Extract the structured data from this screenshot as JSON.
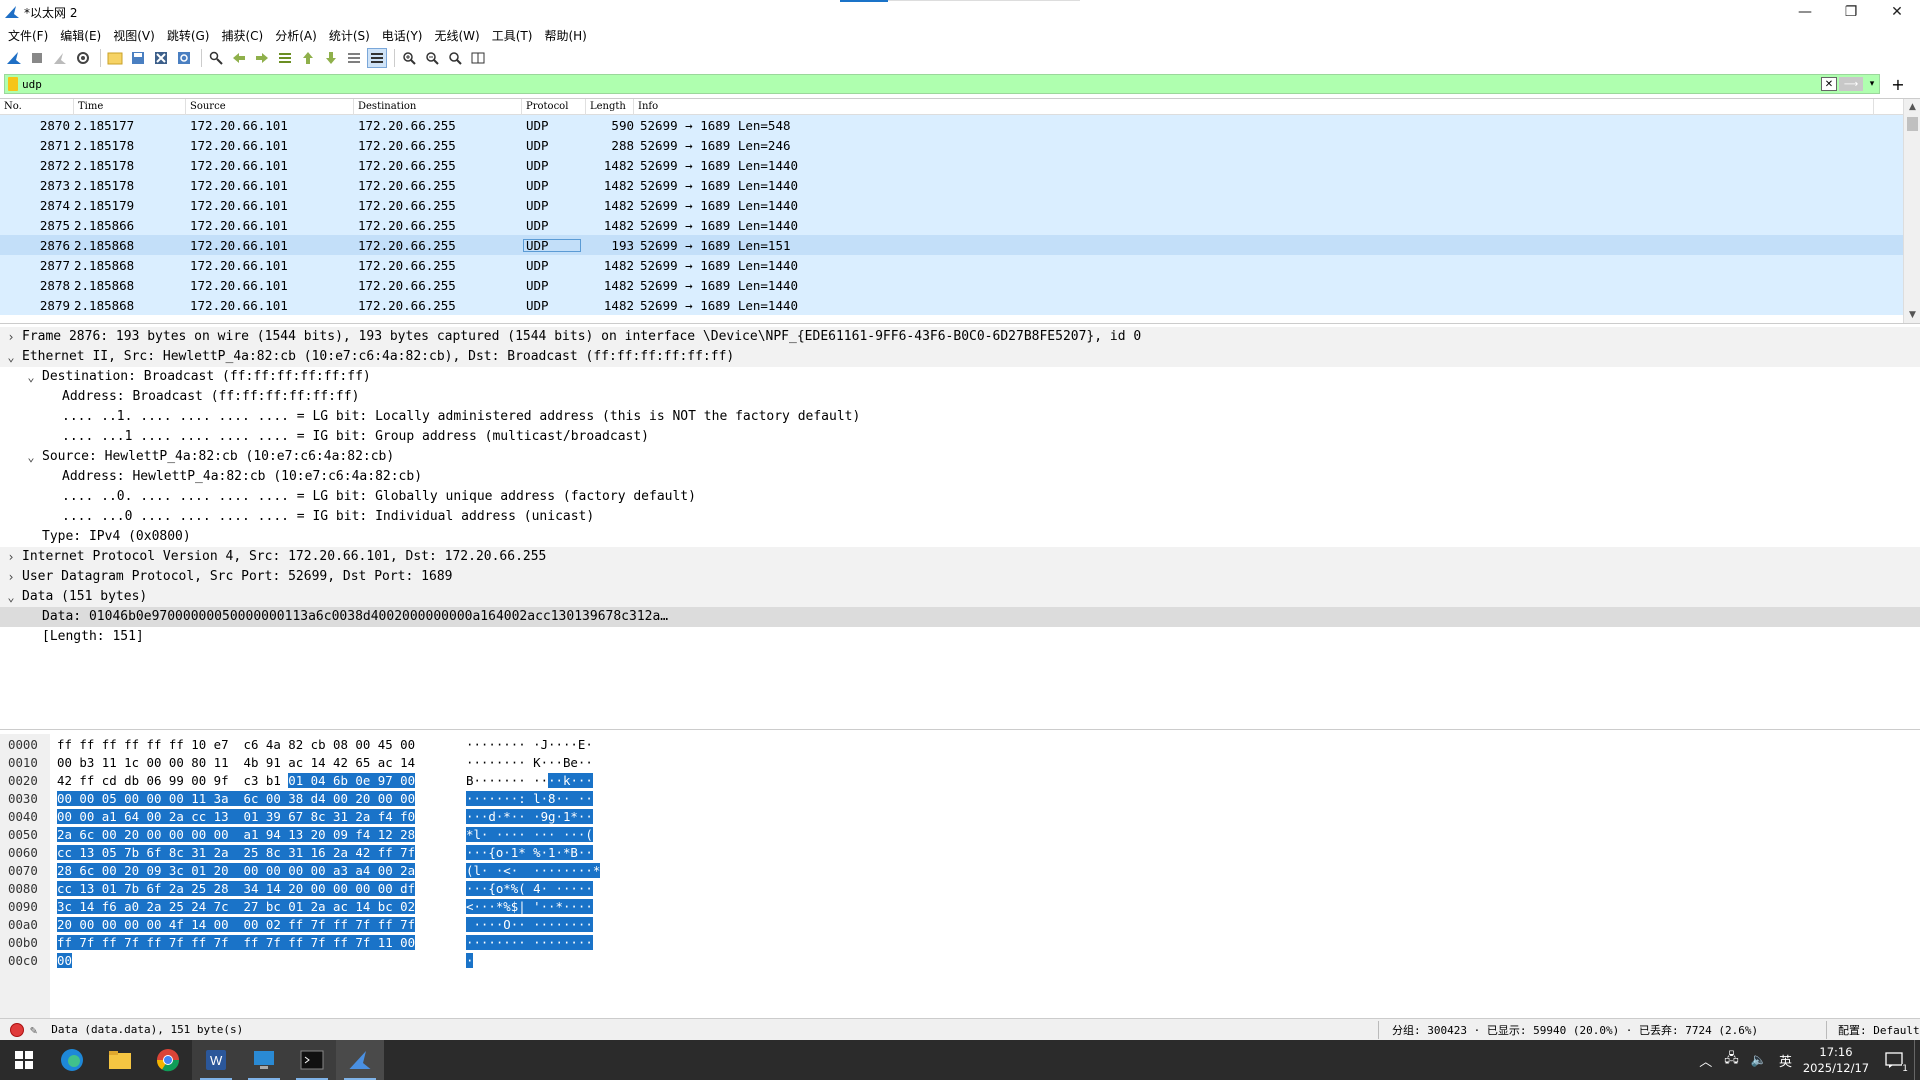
{
  "window": {
    "title": "*以太网 2",
    "minimize": "—",
    "maximize": "❐",
    "close": "✕"
  },
  "menu": [
    "文件(F)",
    "编辑(E)",
    "视图(V)",
    "跳转(G)",
    "捕获(C)",
    "分析(A)",
    "统计(S)",
    "电话(Y)",
    "无线(W)",
    "工具(T)",
    "帮助(H)"
  ],
  "filter": {
    "value": "udp",
    "add": "+"
  },
  "packet_list": {
    "columns": [
      "No.",
      "Time",
      "Source",
      "Destination",
      "Protocol",
      "Length",
      "Info"
    ],
    "rows": [
      {
        "no": "2870",
        "time": "2.185177",
        "src": "172.20.66.101",
        "dst": "172.20.66.255",
        "proto": "UDP",
        "len": "590",
        "info": "52699 → 1689 Len=548"
      },
      {
        "no": "2871",
        "time": "2.185178",
        "src": "172.20.66.101",
        "dst": "172.20.66.255",
        "proto": "UDP",
        "len": "288",
        "info": "52699 → 1689 Len=246"
      },
      {
        "no": "2872",
        "time": "2.185178",
        "src": "172.20.66.101",
        "dst": "172.20.66.255",
        "proto": "UDP",
        "len": "1482",
        "info": "52699 → 1689 Len=1440"
      },
      {
        "no": "2873",
        "time": "2.185178",
        "src": "172.20.66.101",
        "dst": "172.20.66.255",
        "proto": "UDP",
        "len": "1482",
        "info": "52699 → 1689 Len=1440"
      },
      {
        "no": "2874",
        "time": "2.185179",
        "src": "172.20.66.101",
        "dst": "172.20.66.255",
        "proto": "UDP",
        "len": "1482",
        "info": "52699 → 1689 Len=1440"
      },
      {
        "no": "2875",
        "time": "2.185866",
        "src": "172.20.66.101",
        "dst": "172.20.66.255",
        "proto": "UDP",
        "len": "1482",
        "info": "52699 → 1689 Len=1440"
      },
      {
        "no": "2876",
        "time": "2.185868",
        "src": "172.20.66.101",
        "dst": "172.20.66.255",
        "proto": "UDP",
        "len": "193",
        "info": "52699 → 1689 Len=151"
      },
      {
        "no": "2877",
        "time": "2.185868",
        "src": "172.20.66.101",
        "dst": "172.20.66.255",
        "proto": "UDP",
        "len": "1482",
        "info": "52699 → 1689 Len=1440"
      },
      {
        "no": "2878",
        "time": "2.185868",
        "src": "172.20.66.101",
        "dst": "172.20.66.255",
        "proto": "UDP",
        "len": "1482",
        "info": "52699 → 1689 Len=1440"
      },
      {
        "no": "2879",
        "time": "2.185868",
        "src": "172.20.66.101",
        "dst": "172.20.66.255",
        "proto": "UDP",
        "len": "1482",
        "info": "52699 → 1689 Len=1440"
      }
    ],
    "selected_index": 6
  },
  "details": [
    {
      "indent": 0,
      "toggle": "›",
      "text": "Frame 2876: 193 bytes on wire (1544 bits), 193 bytes captured (1544 bits) on interface \\Device\\NPF_{EDE61161-9FF6-43F6-B0C0-6D27B8FE5207}, id 0",
      "style": "grey"
    },
    {
      "indent": 0,
      "toggle": "⌄",
      "text": "Ethernet II, Src: HewlettP_4a:82:cb (10:e7:c6:4a:82:cb), Dst: Broadcast (ff:ff:ff:ff:ff:ff)",
      "style": "grey"
    },
    {
      "indent": 1,
      "toggle": "⌄",
      "text": "Destination: Broadcast (ff:ff:ff:ff:ff:ff)",
      "style": ""
    },
    {
      "indent": 2,
      "toggle": "",
      "text": "Address: Broadcast (ff:ff:ff:ff:ff:ff)",
      "style": ""
    },
    {
      "indent": 2,
      "toggle": "",
      "text": ".... ..1. .... .... .... .... = LG bit: Locally administered address (this is NOT the factory default)",
      "style": ""
    },
    {
      "indent": 2,
      "toggle": "",
      "text": ".... ...1 .... .... .... .... = IG bit: Group address (multicast/broadcast)",
      "style": ""
    },
    {
      "indent": 1,
      "toggle": "⌄",
      "text": "Source: HewlettP_4a:82:cb (10:e7:c6:4a:82:cb)",
      "style": ""
    },
    {
      "indent": 2,
      "toggle": "",
      "text": "Address: HewlettP_4a:82:cb (10:e7:c6:4a:82:cb)",
      "style": ""
    },
    {
      "indent": 2,
      "toggle": "",
      "text": ".... ..0. .... .... .... .... = LG bit: Globally unique address (factory default)",
      "style": ""
    },
    {
      "indent": 2,
      "toggle": "",
      "text": ".... ...0 .... .... .... .... = IG bit: Individual address (unicast)",
      "style": ""
    },
    {
      "indent": 1,
      "toggle": "",
      "text": "Type: IPv4 (0x0800)",
      "style": ""
    },
    {
      "indent": 0,
      "toggle": "›",
      "text": "Internet Protocol Version 4, Src: 172.20.66.101, Dst: 172.20.66.255",
      "style": "grey"
    },
    {
      "indent": 0,
      "toggle": "›",
      "text": "User Datagram Protocol, Src Port: 52699, Dst Port: 1689",
      "style": "grey"
    },
    {
      "indent": 0,
      "toggle": "⌄",
      "text": "Data (151 bytes)",
      "style": "grey"
    },
    {
      "indent": 1,
      "toggle": "",
      "text": "Data: 01046b0e97000000050000000113a6c0038d4002000000000a164002acc130139678c312a…",
      "style": "hl"
    },
    {
      "indent": 1,
      "toggle": "",
      "text": "[Length: 151]",
      "style": ""
    }
  ],
  "hex": [
    {
      "off": "0000",
      "pre": "ff ff ff ff ff ff 10 e7  c6 4a 82 cb 08 00 45 00",
      "sel": "",
      "apre": "········ ·J····E·",
      "asel": ""
    },
    {
      "off": "0010",
      "pre": "00 b3 11 1c 00 00 80 11  4b 91 ac 14 42 65 ac 14",
      "sel": "",
      "apre": "········ K···Be··",
      "asel": ""
    },
    {
      "off": "0020",
      "pre": "42 ff cd db 06 99 00 9f  c3 b1 ",
      "sel": "01 04 6b 0e 97 00",
      "apre": "B······· ··",
      "asel": "··k···"
    },
    {
      "off": "0030",
      "pre": "",
      "sel": "00 00 05 00 00 00 11 3a  6c 00 38 d4 00 20 00 00",
      "apre": "",
      "asel": "·······: l·8·· ··"
    },
    {
      "off": "0040",
      "pre": "",
      "sel": "00 00 a1 64 00 2a cc 13  01 39 67 8c 31 2a f4 f0",
      "apre": "",
      "asel": "···d·*·· ·9g·1*··"
    },
    {
      "off": "0050",
      "pre": "",
      "sel": "2a 6c 00 20 00 00 00 00  a1 94 13 20 09 f4 12 28",
      "apre": "",
      "asel": "*l· ···· ··· ···("
    },
    {
      "off": "0060",
      "pre": "",
      "sel": "cc 13 05 7b 6f 8c 31 2a  25 8c 31 16 2a 42 ff 7f",
      "apre": "",
      "asel": "···{o·1* %·1·*B··"
    },
    {
      "off": "0070",
      "pre": "",
      "sel": "28 6c 00 20 09 3c 01 20  00 00 00 00 a3 a4 00 2a",
      "apre": "",
      "asel": "(l· ·<·  ········*"
    },
    {
      "off": "0080",
      "pre": "",
      "sel": "cc 13 01 7b 6f 2a 25 28  34 14 20 00 00 00 00 df",
      "apre": "",
      "asel": "···{o*%( 4· ·····"
    },
    {
      "off": "0090",
      "pre": "",
      "sel": "3c 14 f6 a0 2a 25 24 7c  27 bc 01 2a ac 14 bc 02",
      "apre": "",
      "asel": "<···*%$| '··*····"
    },
    {
      "off": "00a0",
      "pre": "",
      "sel": "20 00 00 00 00 4f 14 00  00 02 ff 7f ff 7f ff 7f",
      "apre": "",
      "asel": " ····O·· ········"
    },
    {
      "off": "00b0",
      "pre": "",
      "sel": "ff 7f ff 7f ff 7f ff 7f  ff 7f ff 7f ff 7f 11 00",
      "apre": "",
      "asel": "········ ········"
    },
    {
      "off": "00c0",
      "pre": "",
      "sel": "00",
      "apre": "",
      "asel": "·"
    }
  ],
  "status": {
    "field": "Data (data.data), 151 byte(s)",
    "counts": "分组: 300423 · 已显示: 59940 (20.0%) · 已丢弃: 7724 (2.6%)",
    "profile": "配置: Default"
  },
  "taskbar": {
    "clock_time": "17:16",
    "clock_date": "2025/12/17",
    "ime": "英",
    "notifications": "1"
  }
}
